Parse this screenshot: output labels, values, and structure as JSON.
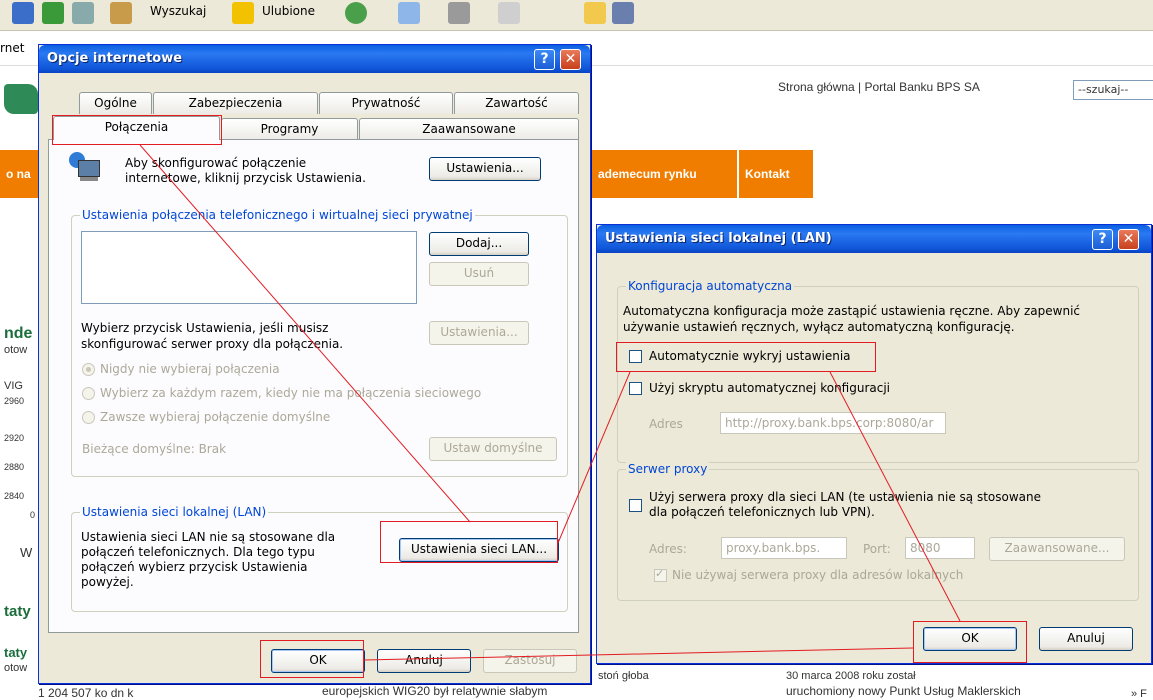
{
  "browser": {
    "toolbar_search": "Wyszukaj",
    "toolbar_favorites": "Ulubione",
    "address_label": "rnet",
    "site_links": "Strona główna | Portal Banku BPS SA",
    "search_placeholder": "--szukaj--",
    "nav_left": "o na",
    "nav_vademecum": "ademecum rynku",
    "nav_kontakt": "Kontakt",
    "left_snippets": [
      "nde",
      "otow",
      "VIG",
      "2960",
      "2920",
      "2880",
      "2840",
      "0",
      "W",
      "taty",
      "taty",
      "otow"
    ],
    "bottom_news_left": "europejskich WIG20 był relatywnie słabym",
    "bottom_news_left_top": "stoń głoba",
    "bottom_news_right_top": "30 marca 2008 roku został",
    "bottom_news_right": "uruchomiony nowy Punkt Usług Maklerskich",
    "bottom_news_far": "» F",
    "bottom_left_partial": "1 204 507 ko dn k"
  },
  "internet_options": {
    "title": "Opcje internetowe",
    "tabs_row1": [
      "Ogólne",
      "Zabezpieczenia",
      "Prywatność",
      "Zawartość"
    ],
    "tabs_row2": [
      "Połączenia",
      "Programy",
      "Zaawansowane"
    ],
    "setup_text_1": "Aby skonfigurować połączenie",
    "setup_text_2": "internetowe, kliknij przycisk Ustawienia.",
    "setup_button": "Ustawienia...",
    "dialup_group": "Ustawienia połączenia telefonicznego i wirtualnej sieci prywatnej",
    "add_button": "Dodaj...",
    "remove_button": "Usuń",
    "settings_button": "Ustawienia...",
    "proxy_hint_1": "Wybierz przycisk Ustawienia, jeśli musisz",
    "proxy_hint_2": "skonfigurować serwer proxy dla połączenia.",
    "radio_never": "Nigdy nie wybieraj połączenia",
    "radio_when_no_net": "Wybierz za każdym razem, kiedy nie ma połączenia sieciowego",
    "radio_always": "Zawsze wybieraj połączenie domyślne",
    "current_default": "Bieżące domyślne:  Brak",
    "set_default_button": "Ustaw domyślne",
    "lan_group": "Ustawienia sieci lokalnej (LAN)",
    "lan_text": [
      "Ustawienia sieci LAN nie są stosowane dla",
      "połączeń telefonicznych. Dla tego typu",
      "połączeń wybierz przycisk Ustawienia",
      "powyżej."
    ],
    "lan_button": "Ustawienia sieci LAN...",
    "ok": "OK",
    "cancel": "Anuluj",
    "apply": "Zastosuj"
  },
  "lan_settings": {
    "title": "Ustawienia sieci lokalnej (LAN)",
    "auto_group": "Konfiguracja automatyczna",
    "auto_desc_1": "Automatyczna konfiguracja może zastąpić ustawienia ręczne. Aby zapewnić",
    "auto_desc_2": "używanie ustawień ręcznych, wyłącz automatyczną konfigurację.",
    "auto_detect": "Automatycznie wykryj ustawienia",
    "use_script": "Użyj skryptu automatycznej konfiguracji",
    "address_label": "Adres",
    "script_address": "http://proxy.bank.bps.corp:8080/ar",
    "proxy_group": "Serwer proxy",
    "use_proxy_1": "Użyj serwera proxy dla sieci LAN (te ustawienia nie są stosowane",
    "use_proxy_2": "dla połączeń telefonicznych lub VPN).",
    "proxy_address_label": "Adres:",
    "proxy_address": "proxy.bank.bps.",
    "port_label": "Port:",
    "port": "8080",
    "advanced_button": "Zaawansowane...",
    "bypass_local": "Nie używaj serwera proxy dla adresów lokalnych",
    "ok": "OK",
    "cancel": "Anuluj"
  },
  "colors": {
    "xp_blue": "#0a5fe0",
    "highlight_red": "#e31b23",
    "nav_orange": "#f07d00",
    "group_label": "#0046d5"
  }
}
